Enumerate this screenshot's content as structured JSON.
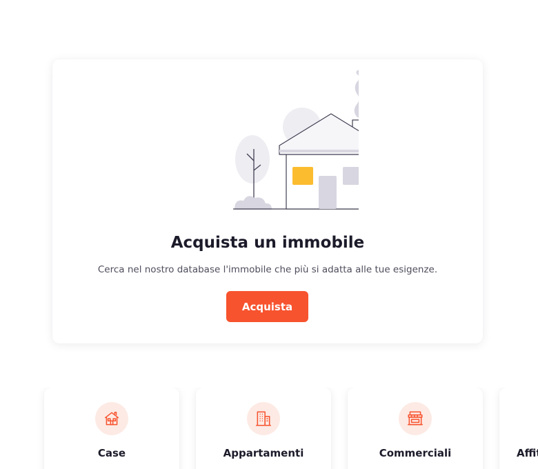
{
  "hero": {
    "title": "Acquista un immobile",
    "subtitle": "Cerca nel nostro database l'immobile che più si adatta alle tue esigenze.",
    "button_label": "Acquista",
    "illustration_icon": "house-with-plus-icon"
  },
  "categories": [
    {
      "label": "Case",
      "icon": "house-icon"
    },
    {
      "label": "Appartamenti",
      "icon": "apartment-building-icon"
    },
    {
      "label": "Commerciali",
      "icon": "storefront-icon"
    },
    {
      "label": "Affitti",
      "icon": "rent-icon"
    }
  ],
  "colors": {
    "accent": "#f7532e",
    "accent_soft": "#fdeae4",
    "text_dark": "#1c1b2a",
    "text_muted": "#4e4d5c",
    "window_yellow": "#fbbc2f",
    "plus_badge": "#1c1b2a"
  }
}
